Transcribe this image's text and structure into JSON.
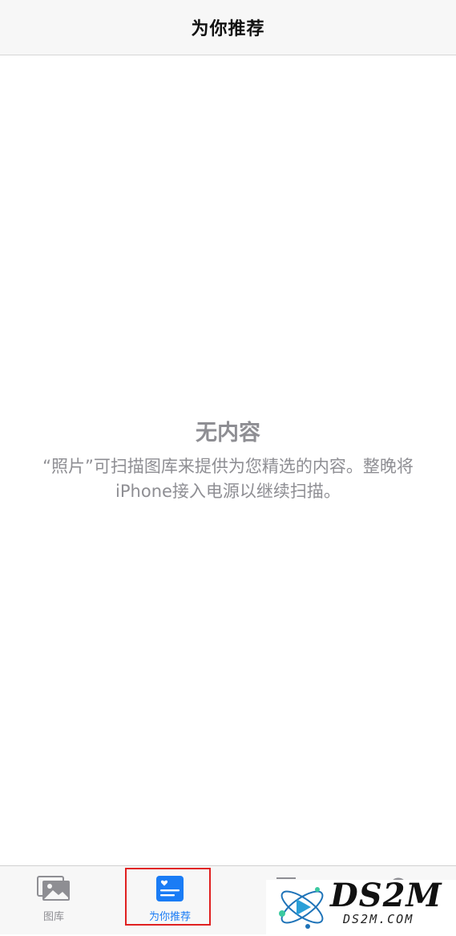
{
  "nav": {
    "title": "为你推荐"
  },
  "empty_state": {
    "title": "无内容",
    "description": "“照片”可扫描图库来提供为您精选的内容。整晚将iPhone接入电源以继续扫描。"
  },
  "tabs": [
    {
      "label": "图库",
      "icon": "photo-library-icon",
      "active": false
    },
    {
      "label": "为你推荐",
      "icon": "for-you-icon",
      "active": true
    },
    {
      "label": "",
      "icon": "albums-icon",
      "active": false
    },
    {
      "label": "",
      "icon": "search-icon",
      "active": false
    }
  ],
  "watermark": {
    "brand": "DS2M",
    "domain": "DS2M.COM"
  },
  "colors": {
    "accent": "#1a7cf5",
    "secondary_text": "#8e8e93",
    "bar_background": "#f7f7f7",
    "highlight": "#e02020"
  }
}
